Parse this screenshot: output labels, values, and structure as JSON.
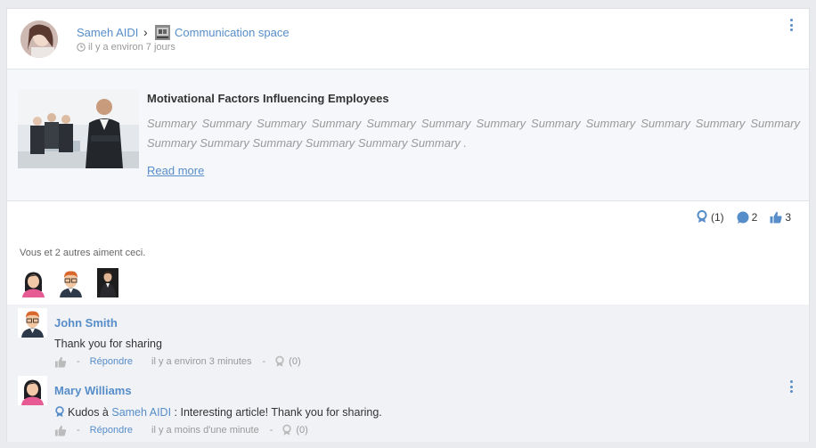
{
  "post": {
    "author": "Sameh AIDI",
    "separator": "›",
    "space": "Communication space",
    "time": "il y a environ 7 jours"
  },
  "article": {
    "title": "Motivational Factors Influencing Employees",
    "summary": "Summary Summary Summary Summary Summary Summary Summary Summary Summary Summary Summary Summary Summary Summary Summary Summary Summary Summary .",
    "read_more": "Read more"
  },
  "stats": {
    "kudos": "(1)",
    "comments": "2",
    "likes": "3"
  },
  "likers_text": "Vous et 2 autres aiment ceci.",
  "comments": [
    {
      "author": "John Smith",
      "text": "Thank you for sharing",
      "reply_label": "Répondre",
      "time": "il y a environ 3 minutes",
      "kudos_count": "(0)"
    },
    {
      "author": "Mary Williams",
      "kudos_prefix": "Kudos à",
      "kudos_target": "Sameh AIDI",
      "text": ": Interesting article! Thank you for sharing.",
      "reply_label": "Répondre",
      "time": "il y a moins d'une minute",
      "kudos_count": "(0)"
    }
  ],
  "colors": {
    "link": "#578dc9",
    "muted": "#999999",
    "article_bg": "#f6f7fa",
    "comments_bg": "#f0f2f5"
  }
}
